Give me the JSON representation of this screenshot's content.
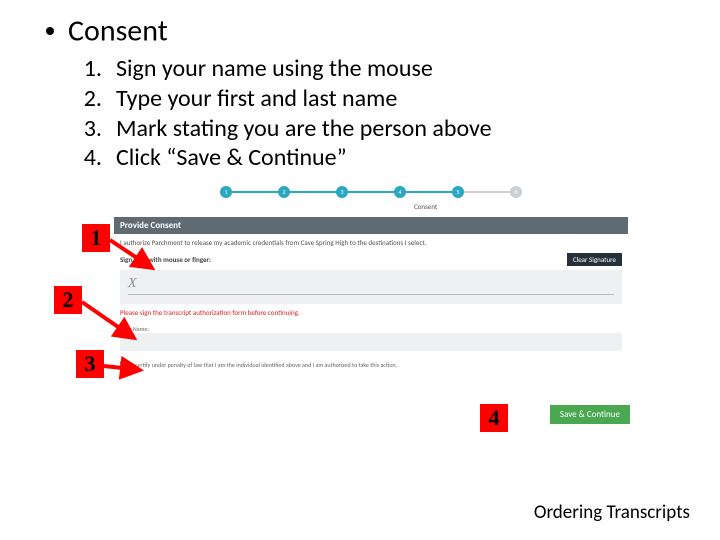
{
  "title": "Consent",
  "steps": [
    {
      "n": "1.",
      "text": "Sign your name using the mouse"
    },
    {
      "n": "2.",
      "text": "Type your first and last name"
    },
    {
      "n": "3.",
      "text": "Mark stating you are the person above"
    },
    {
      "n": "4.",
      "text": "Click “Save & Continue”"
    }
  ],
  "callouts": {
    "c1": "1",
    "c2": "2",
    "c3": "3",
    "c4": "4"
  },
  "screenshot": {
    "step_label": "Consent",
    "panel_heading": "Provide Consent",
    "panel_sub": "I authorize Parchment to release my academic credentials from Cave Spring High to the destinations I select.",
    "sign_label": "Sign here with mouse or finger:",
    "clear_btn": "Clear Signature",
    "sign_x": "X",
    "warn": "Please sign the transcript authorization form before continuing.",
    "type_label": "Type Name:",
    "certify": "I certify under penalty of law that I am the individual identified above and I am authorized to take this action.",
    "save_btn": "Save & Continue"
  },
  "footer": "Ordering Transcripts"
}
